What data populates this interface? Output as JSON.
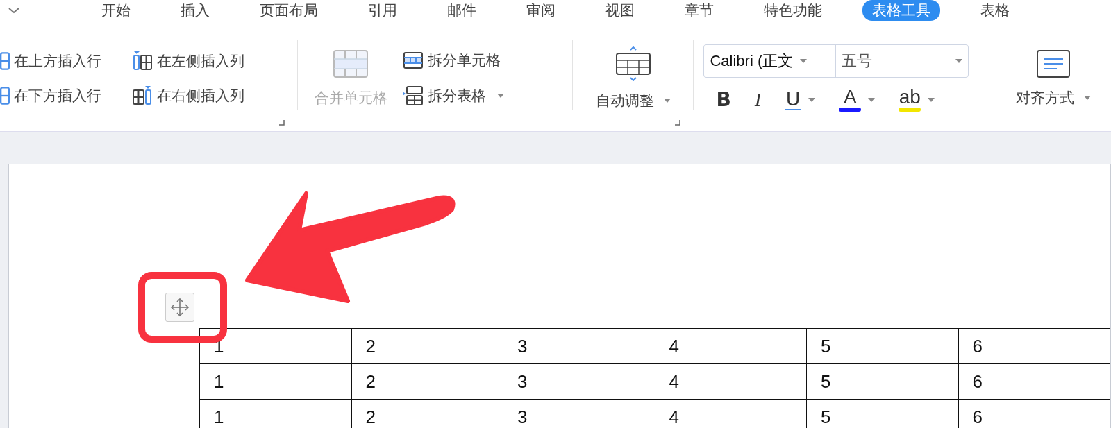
{
  "menu_tabs": [
    {
      "label": "开始",
      "selected": false
    },
    {
      "label": "插入",
      "selected": false
    },
    {
      "label": "页面布局",
      "selected": false
    },
    {
      "label": "引用",
      "selected": false
    },
    {
      "label": "邮件",
      "selected": false
    },
    {
      "label": "审阅",
      "selected": false
    },
    {
      "label": "视图",
      "selected": false
    },
    {
      "label": "章节",
      "selected": false
    },
    {
      "label": "特色功能",
      "selected": false
    },
    {
      "label": "表格工具",
      "selected": true
    },
    {
      "label": "表格",
      "selected": false
    }
  ],
  "ribbon": {
    "insert_buttons": [
      {
        "label": "在上方插入行",
        "kind": "row_above"
      },
      {
        "label": "在左侧插入列",
        "kind": "col_left"
      },
      {
        "label": "在下方插入行",
        "kind": "row_below"
      },
      {
        "label": "在右侧插入列",
        "kind": "col_right"
      }
    ],
    "merge_cells": {
      "label": "合并单元格",
      "disabled": true
    },
    "split_cells": "拆分单元格",
    "split_table": "拆分表格",
    "auto_fit": "自动调整",
    "font_name": "Calibri (正文",
    "font_size": "五号",
    "format_buttons": [
      {
        "label": "B",
        "kind": "bold"
      },
      {
        "label": "I",
        "kind": "italic"
      },
      {
        "label": "U",
        "kind": "underline"
      },
      {
        "label": "A",
        "kind": "font_color",
        "color": "#1a1aff"
      },
      {
        "label": "ab",
        "kind": "highlight",
        "color": "#f2e600"
      }
    ],
    "align": "对齐方式"
  },
  "table": {
    "rows": [
      [
        "1",
        "2",
        "3",
        "4",
        "5",
        "6"
      ],
      [
        "1",
        "2",
        "3",
        "4",
        "5",
        "6"
      ],
      [
        "1",
        "2",
        "3",
        "4",
        "5",
        "6"
      ]
    ]
  }
}
